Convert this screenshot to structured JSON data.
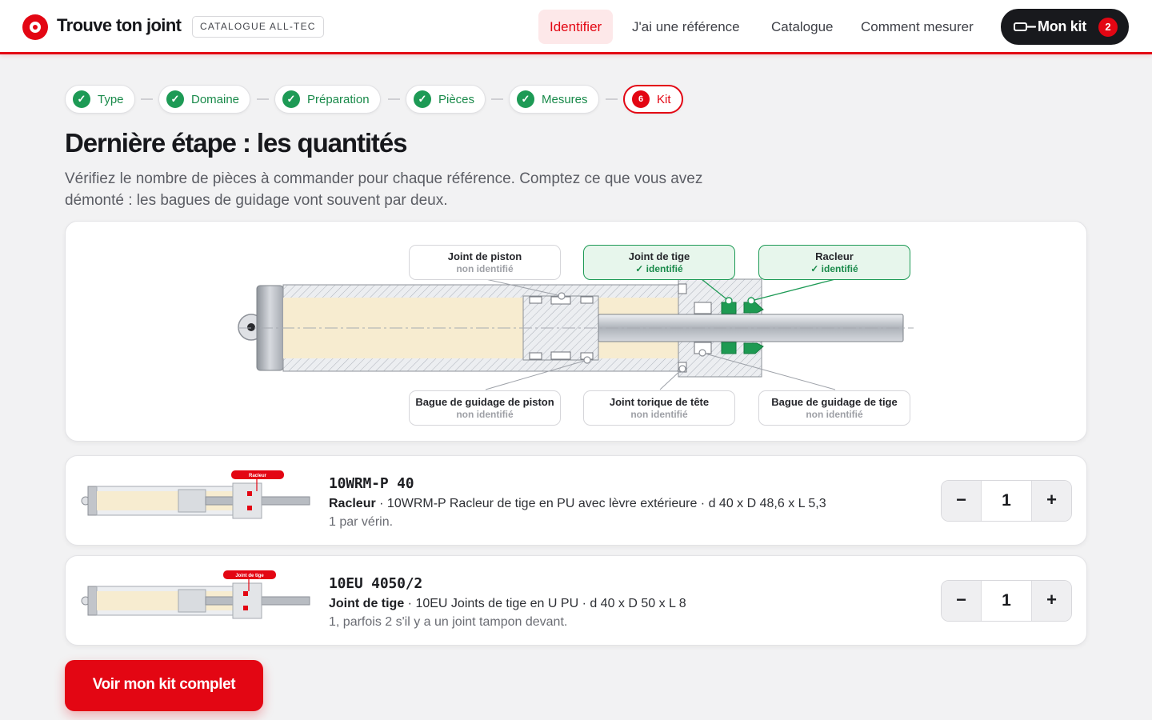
{
  "header": {
    "brand": "Trouve ton joint",
    "catalog_badge": "CATALOGUE ALL-TEC",
    "nav": [
      {
        "label": "Identifier",
        "active": true
      },
      {
        "label": "J'ai une référence",
        "active": false
      },
      {
        "label": "Catalogue",
        "active": false
      },
      {
        "label": "Comment mesurer",
        "active": false
      }
    ],
    "kit": {
      "label": "Mon kit",
      "count": "2"
    }
  },
  "colors": {
    "accent": "#e30613",
    "success": "#1d9a55",
    "dark": "#18191d"
  },
  "stepper": [
    {
      "label": "Type",
      "state": "done",
      "icon": "check-icon"
    },
    {
      "label": "Domaine",
      "state": "done",
      "icon": "check-icon"
    },
    {
      "label": "Préparation",
      "state": "done",
      "icon": "check-icon"
    },
    {
      "label": "Pièces",
      "state": "done",
      "icon": "check-icon"
    },
    {
      "label": "Mesures",
      "state": "done",
      "icon": "check-icon"
    },
    {
      "label": "Kit",
      "state": "current",
      "number": "6"
    }
  ],
  "page": {
    "title": "Dernière étape : les quantités",
    "intro": "Vérifiez le nombre de pièces à commander pour chaque référence. Comptez ce que vous avez démonté : les bagues de guidage vont souvent par deux."
  },
  "diagram": {
    "callouts": [
      {
        "name": "Joint de piston",
        "status": "non identifié",
        "identified": false
      },
      {
        "name": "Joint de tige",
        "status": "✓ identifié",
        "identified": true
      },
      {
        "name": "Racleur",
        "status": "✓ identifié",
        "identified": true
      },
      {
        "name": "Bague de guidage de piston",
        "status": "non identifié",
        "identified": false
      },
      {
        "name": "Joint torique de tête",
        "status": "non identifié",
        "identified": false
      },
      {
        "name": "Bague de guidage de tige",
        "status": "non identifié",
        "identified": false
      }
    ]
  },
  "products": [
    {
      "thumb_label": "Racleur",
      "ref": "10WRM-P 40",
      "type": "Racleur",
      "description": " · 10WRM-P Racleur de tige en PU avec lèvre extérieure · d 40 x D 48,6 x L 5,3",
      "note": "1 par vérin.",
      "quantity": "1"
    },
    {
      "thumb_label": "Joint de tige",
      "ref": "10EU 4050/2",
      "type": "Joint de tige",
      "description": " · 10EU Joints de tige en U PU · d 40 x D 50 x L 8",
      "note": "1, parfois 2 s'il y a un joint tampon devant.",
      "quantity": "1"
    }
  ],
  "quantity_controls": {
    "minus": "−",
    "plus": "+"
  },
  "cta": {
    "label": "Voir mon kit complet"
  }
}
